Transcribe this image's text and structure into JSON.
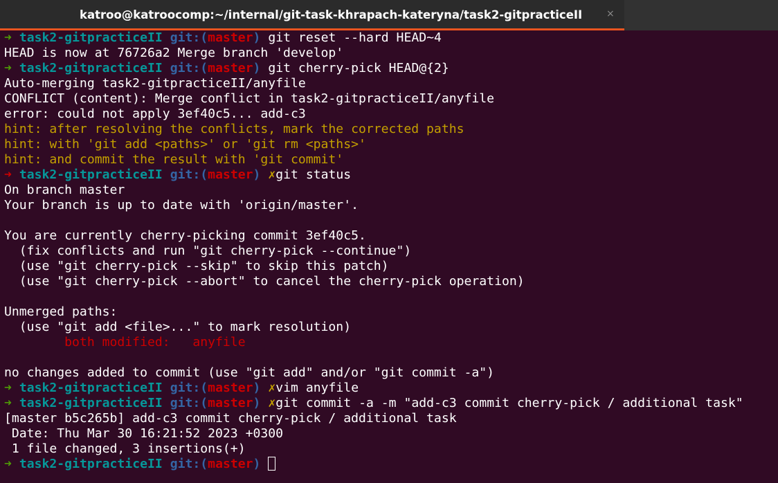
{
  "window": {
    "tab_title": "katroo@katroocomp:~/internal/git-task-khrapach-kateryna/task2-gitpracticeII",
    "close_glyph": "×"
  },
  "prompt": {
    "arrow": "➜",
    "dir": "task2-gitpracticeII",
    "git_label_open": "git:(",
    "branch": "master",
    "git_label_close": ")",
    "dirty_mark": "✗"
  },
  "terminal": {
    "cmd1": "git reset --hard HEAD~4",
    "out1": "HEAD is now at 76726a2 Merge branch 'develop'",
    "cmd2": "git cherry-pick HEAD@{2}",
    "out2_1": "Auto-merging task2-gitpracticeII/anyfile",
    "out2_2": "CONFLICT (content): Merge conflict in task2-gitpracticeII/anyfile",
    "out2_3": "error: could not apply 3ef40c5... add-c3",
    "hint1": "hint: after resolving the conflicts, mark the corrected paths",
    "hint2": "hint: with 'git add <paths>' or 'git rm <paths>'",
    "hint3": "hint: and commit the result with 'git commit'",
    "cmd3": "git status",
    "st1": "On branch master",
    "st2": "Your branch is up to date with 'origin/master'.",
    "st3": "You are currently cherry-picking commit 3ef40c5.",
    "st4": "  (fix conflicts and run \"git cherry-pick --continue\")",
    "st5": "  (use \"git cherry-pick --skip\" to skip this patch)",
    "st6": "  (use \"git cherry-pick --abort\" to cancel the cherry-pick operation)",
    "st7": "Unmerged paths:",
    "st8": "  (use \"git add <file>...\" to mark resolution)",
    "st9": "        both modified:   anyfile",
    "st10": "no changes added to commit (use \"git add\" and/or \"git commit -a\")",
    "cmd4": "vim anyfile",
    "cmd5": "git commit -a -m \"add-c3 commit cherry-pick / additional task\"",
    "c1": "[master b5c265b] add-c3 commit cherry-pick / additional task",
    "c2": " Date: Thu Mar 30 16:21:52 2023 +0300",
    "c3": " 1 file changed, 3 insertions(+)"
  },
  "colors": {
    "background": "#300a24",
    "prompt_ok": "#4e9a06",
    "prompt_error": "#cc0000",
    "directory": "#06989a",
    "git_label": "#3465a4",
    "branch": "#cc0000",
    "hint": "#c4a000",
    "tab_accent": "#e95420"
  }
}
